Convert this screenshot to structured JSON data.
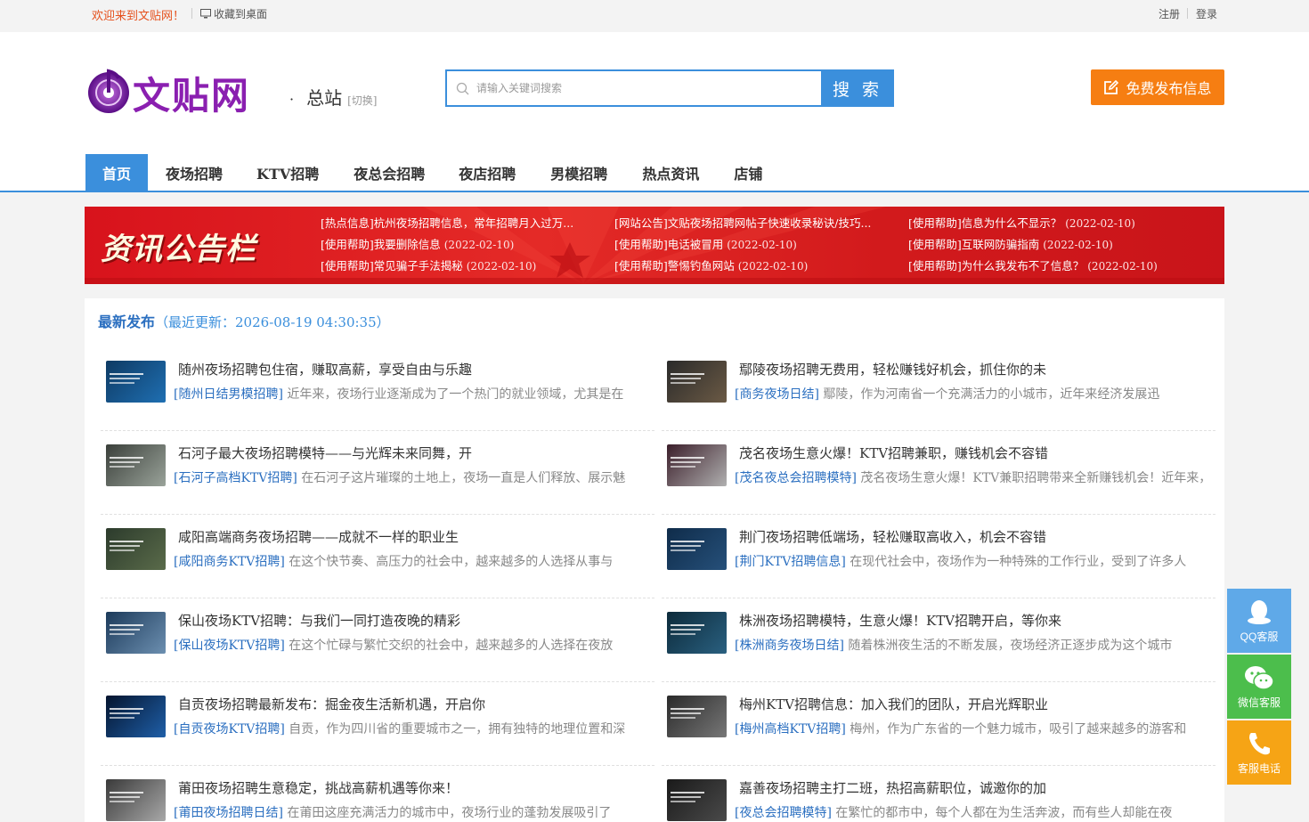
{
  "topbar": {
    "welcome": "欢迎来到文贴网！",
    "favorite": "收藏到桌面",
    "register": "注册",
    "login": "登录"
  },
  "header": {
    "logo_text": "文贴网",
    "site_name": "总站",
    "site_switch": "[切换]",
    "search_placeholder": "请输入关键词搜索",
    "search_button": "搜 索",
    "publish_button": "免费发布信息"
  },
  "nav": {
    "items": [
      "首页",
      "夜场招聘",
      "KTV招聘",
      "夜总会招聘",
      "夜店招聘",
      "男模招聘",
      "热点资讯",
      "店铺"
    ]
  },
  "notice": {
    "title": "资讯公告栏",
    "items": [
      {
        "text": "[热点信息]杭州夜场招聘信息，常年招聘月入过万...",
        "date": ""
      },
      {
        "text": "[网站公告]文贴夜场招聘网帖子快速收录秘诀/技巧...",
        "date": ""
      },
      {
        "text": "[使用帮助]信息为什么不显示？",
        "date": "(2022-02-10)"
      },
      {
        "text": "[使用帮助]我要删除信息",
        "date": "(2022-02-10)"
      },
      {
        "text": "[使用帮助]电话被冒用",
        "date": "(2022-02-10)"
      },
      {
        "text": "[使用帮助]互联网防骗指南",
        "date": "(2022-02-10)"
      },
      {
        "text": "[使用帮助]常见骗子手法揭秘",
        "date": "(2022-02-10)"
      },
      {
        "text": "[使用帮助]警惕钓鱼网站",
        "date": "(2022-02-10)"
      },
      {
        "text": "[使用帮助]为什么我发布不了信息？",
        "date": "(2022-02-10)"
      }
    ]
  },
  "latest": {
    "heading": "最新发布",
    "updated": "（最近更新：2026-08-19 04:30:35）",
    "items": [
      {
        "title": "随州夜场招聘包住宿，赚取高薪，享受自由与乐趣",
        "tag": "[随州日结男模招聘]",
        "desc": "近年来，夜场行业逐渐成为了一个热门的就业领域，尤其是在"
      },
      {
        "title": "鄢陵夜场招聘无费用，轻松赚钱好机会，抓住你的未",
        "tag": "[商务夜场日结]",
        "desc": "鄢陵，作为河南省一个充满活力的小城市，近年来经济发展迅"
      },
      {
        "title": "石河子最大夜场招聘模特——与光辉未来同舞，开",
        "tag": "[石河子高档KTV招聘]",
        "desc": "在石河子这片璀璨的土地上，夜场一直是人们释放、展示魅"
      },
      {
        "title": "茂名夜场生意火爆！KTV招聘兼职，赚钱机会不容错",
        "tag": "[茂名夜总会招聘模特]",
        "desc": "茂名夜场生意火爆！KTV兼职招聘带来全新赚钱机会！近年来，"
      },
      {
        "title": "咸阳高端商务夜场招聘——成就不一样的职业生",
        "tag": "[咸阳商务KTV招聘]",
        "desc": "在这个快节奏、高压力的社会中，越来越多的人选择从事与"
      },
      {
        "title": "荆门夜场招聘低端场，轻松赚取高收入，机会不容错",
        "tag": "[荆门KTV招聘信息]",
        "desc": "在现代社会中，夜场作为一种特殊的工作行业，受到了许多人"
      },
      {
        "title": "保山夜场KTV招聘：与我们一同打造夜晚的精彩",
        "tag": "[保山夜场KTV招聘]",
        "desc": "在这个忙碌与繁忙交织的社会中，越来越多的人选择在夜放"
      },
      {
        "title": "株洲夜场招聘模特，生意火爆！KTV招聘开启，等你来",
        "tag": "[株洲商务夜场日结]",
        "desc": "随着株洲夜生活的不断发展，夜场经济正逐步成为这个城市"
      },
      {
        "title": "自贡夜场招聘最新发布：掘金夜生活新机遇，开启你",
        "tag": "[自贡夜场KTV招聘]",
        "desc": "自贡，作为四川省的重要城市之一，拥有独特的地理位置和深"
      },
      {
        "title": "梅州KTV招聘信息：加入我们的团队，开启光辉职业",
        "tag": "[梅州高档KTV招聘]",
        "desc": "梅州，作为广东省的一个魅力城市，吸引了越来越多的游客和"
      },
      {
        "title": "莆田夜场招聘生意稳定，挑战高薪机遇等你来！",
        "tag": "[莆田夜场招聘日结]",
        "desc": "在莆田这座充满活力的城市中，夜场行业的蓬勃发展吸引了"
      },
      {
        "title": "嘉善夜场招聘主打二班，热招高薪职位，诚邀你的加",
        "tag": "[夜总会招聘模特]",
        "desc": "在繁忙的都市中，每个人都在为生活奔波，而有些人却能在夜"
      }
    ]
  },
  "float": {
    "qq": "QQ客服",
    "wechat": "微信客服",
    "phone": "客服电话"
  },
  "colors": {
    "accent": "#3b8fdc",
    "orange": "#f67e12",
    "red": "#e5511d",
    "notice_red": "#d8131c"
  }
}
